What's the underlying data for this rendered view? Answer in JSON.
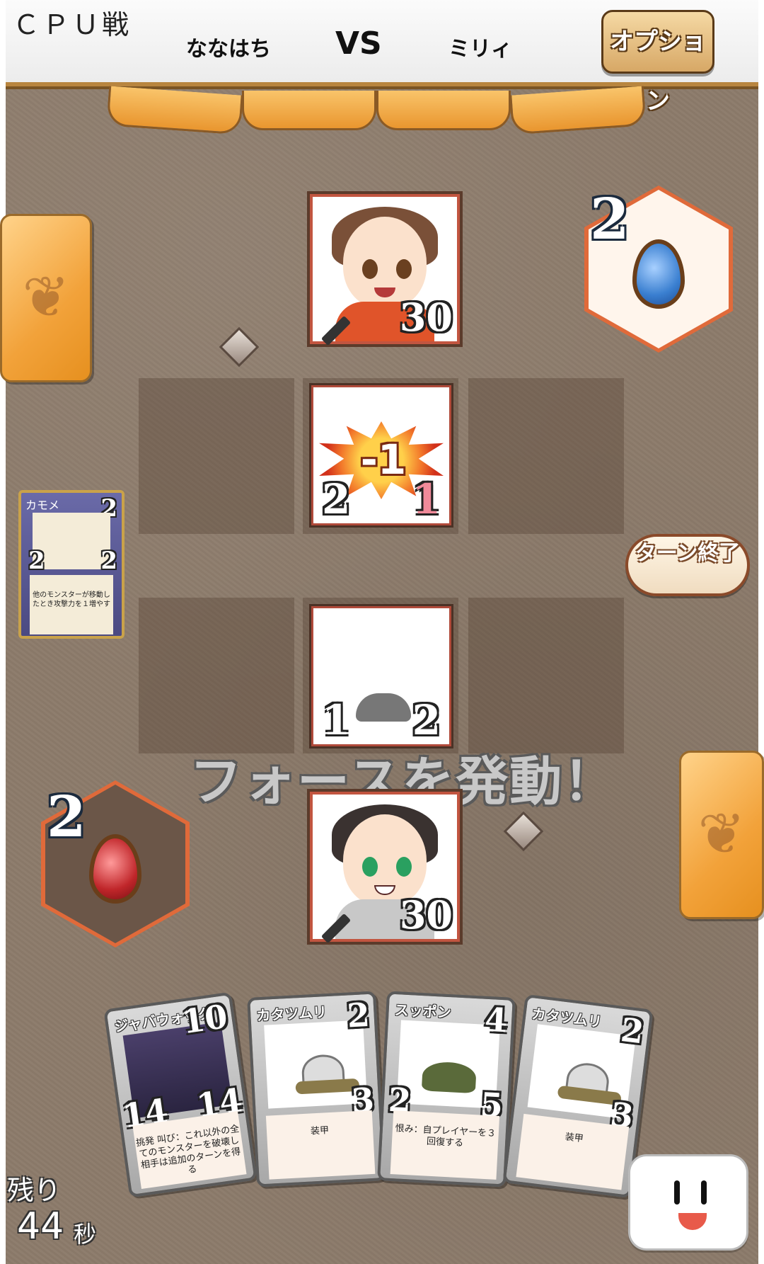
{
  "header": {
    "mode": "ＣＰＵ戦",
    "player1": "ななはち",
    "vs": "VS",
    "player2": "ミリィ",
    "option_label": "オプション"
  },
  "opponent": {
    "hp": "30",
    "mana": "2",
    "mana_color": "#3a7fd0"
  },
  "player": {
    "hp": "30",
    "mana": "2",
    "mana_color": "#c0262a"
  },
  "field": {
    "enemy_card": {
      "attack": "2",
      "defense": "1",
      "damage": "-1"
    },
    "player_card": {
      "attack": "1",
      "defense": "2"
    }
  },
  "info_card": {
    "name": "カモメ",
    "cost": "2",
    "attack": "2",
    "defense": "2",
    "desc": "他のモンスターが移動したとき攻撃力を１増やす"
  },
  "turn_end_label": "ターン終了",
  "message": "フォースを発動！",
  "hand": [
    {
      "name": "ジャバウォック",
      "cost": "10",
      "attack": "14",
      "defense": "14",
      "desc": "挑発 叫び：これ以外の全てのモンスターを破壊し相手は追加のターンを得る"
    },
    {
      "name": "カタツムリ",
      "cost": "2",
      "attack": "",
      "defense": "3",
      "desc": "装甲"
    },
    {
      "name": "スッポン",
      "cost": "4",
      "attack": "2",
      "defense": "5",
      "desc": "恨み：自プレイヤーを３回復する"
    },
    {
      "name": "カタツムリ",
      "cost": "2",
      "attack": "",
      "defense": "3",
      "desc": "装甲"
    }
  ],
  "timer": {
    "label": "残り",
    "value": "44",
    "unit": "秒"
  }
}
